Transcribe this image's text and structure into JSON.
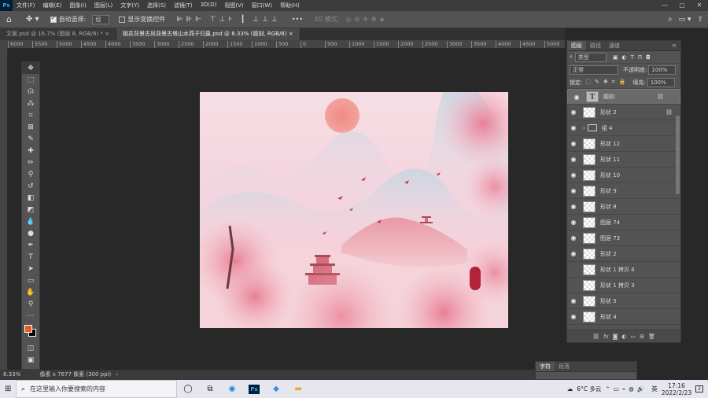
{
  "menu": {
    "items": [
      "文件(F)",
      "编辑(E)",
      "图像(I)",
      "图层(L)",
      "文字(Y)",
      "选择(S)",
      "滤镜(T)",
      "3D(D)",
      "视图(V)",
      "窗口(W)",
      "帮助(H)"
    ],
    "logo": "Ps"
  },
  "window_controls": {
    "minimize": "—",
    "maximize": "▢",
    "close": "✕"
  },
  "options": {
    "auto_select_label": "自动选择:",
    "auto_select_value": "组",
    "show_transform_label": "显示变换控件",
    "mode_3d_label": "3D 模式:",
    "more": "•••"
  },
  "tabs": [
    {
      "label": "文案.psd @ 16.7% (图层 8, RGB/8) *",
      "close": "×"
    },
    {
      "label": "桃花背景古风背景古塔山水燕子归巢.psd @ 8.33% (题刻, RGB/8)",
      "close": "×"
    }
  ],
  "ruler": {
    "labels": [
      "6000",
      "5500",
      "5000",
      "4500",
      "4000",
      "3500",
      "3000",
      "2500",
      "2000",
      "1500",
      "1000",
      "500",
      "0",
      "500",
      "1000",
      "1500",
      "2000",
      "2500",
      "3000",
      "3500",
      "4000",
      "4500",
      "5000",
      "5500",
      "6000",
      "6500",
      "7000",
      "7500",
      "8000",
      "8500",
      "9000",
      "9500",
      "10000",
      "10500",
      "11000",
      "11500"
    ]
  },
  "status": {
    "zoom": "8.33%",
    "doc_info": "像素 x 7677 像素 (300 ppi)"
  },
  "colors": {
    "foreground": "#e85a2a",
    "background": "#000000"
  },
  "layers_panel": {
    "tabs": [
      "图层",
      "路径",
      "通道"
    ],
    "filter_kind": "类型",
    "blend_mode": "正常",
    "opacity_label": "不透明度:",
    "opacity": "100%",
    "lock_label": "锁定:",
    "fill_label": "填充:",
    "fill": "100%",
    "layers": [
      {
        "name": "题刻",
        "type": "text",
        "visible": true,
        "selected": true,
        "linked": true
      },
      {
        "name": "形状 2",
        "type": "shape",
        "visible": true,
        "linked": true
      },
      {
        "name": "组 4",
        "type": "group",
        "visible": true
      },
      {
        "name": "形状 12",
        "type": "shape",
        "visible": true
      },
      {
        "name": "形状 11",
        "type": "shape",
        "visible": true
      },
      {
        "name": "形状 10",
        "type": "shape",
        "visible": true
      },
      {
        "name": "形状 9",
        "type": "shape",
        "visible": true
      },
      {
        "name": "形状 8",
        "type": "shape",
        "visible": true
      },
      {
        "name": "图层 74",
        "type": "pixel",
        "visible": true
      },
      {
        "name": "图层 73",
        "type": "pixel",
        "visible": true
      },
      {
        "name": "形状 2",
        "type": "shape",
        "visible": true
      },
      {
        "name": "形状 1 拷贝 4",
        "type": "shape",
        "visible": false
      },
      {
        "name": "形状 1 拷贝 3",
        "type": "shape",
        "visible": false
      },
      {
        "name": "形状 5",
        "type": "shape",
        "visible": true
      },
      {
        "name": "形状 4",
        "type": "shape",
        "visible": true
      }
    ],
    "footer_icons": [
      "link-icon",
      "fx",
      "mask-icon",
      "adjustment-icon",
      "folder-icon",
      "new-layer-icon",
      "trash-icon"
    ]
  },
  "char_panel": {
    "tabs": [
      "字符",
      "段落"
    ]
  },
  "taskbar": {
    "search_placeholder": "在这里输入你要搜索的内容",
    "weather": "6°C 多云",
    "ime": "英",
    "time": "17:16",
    "date": "2022/2/23",
    "notification_count": "2"
  }
}
